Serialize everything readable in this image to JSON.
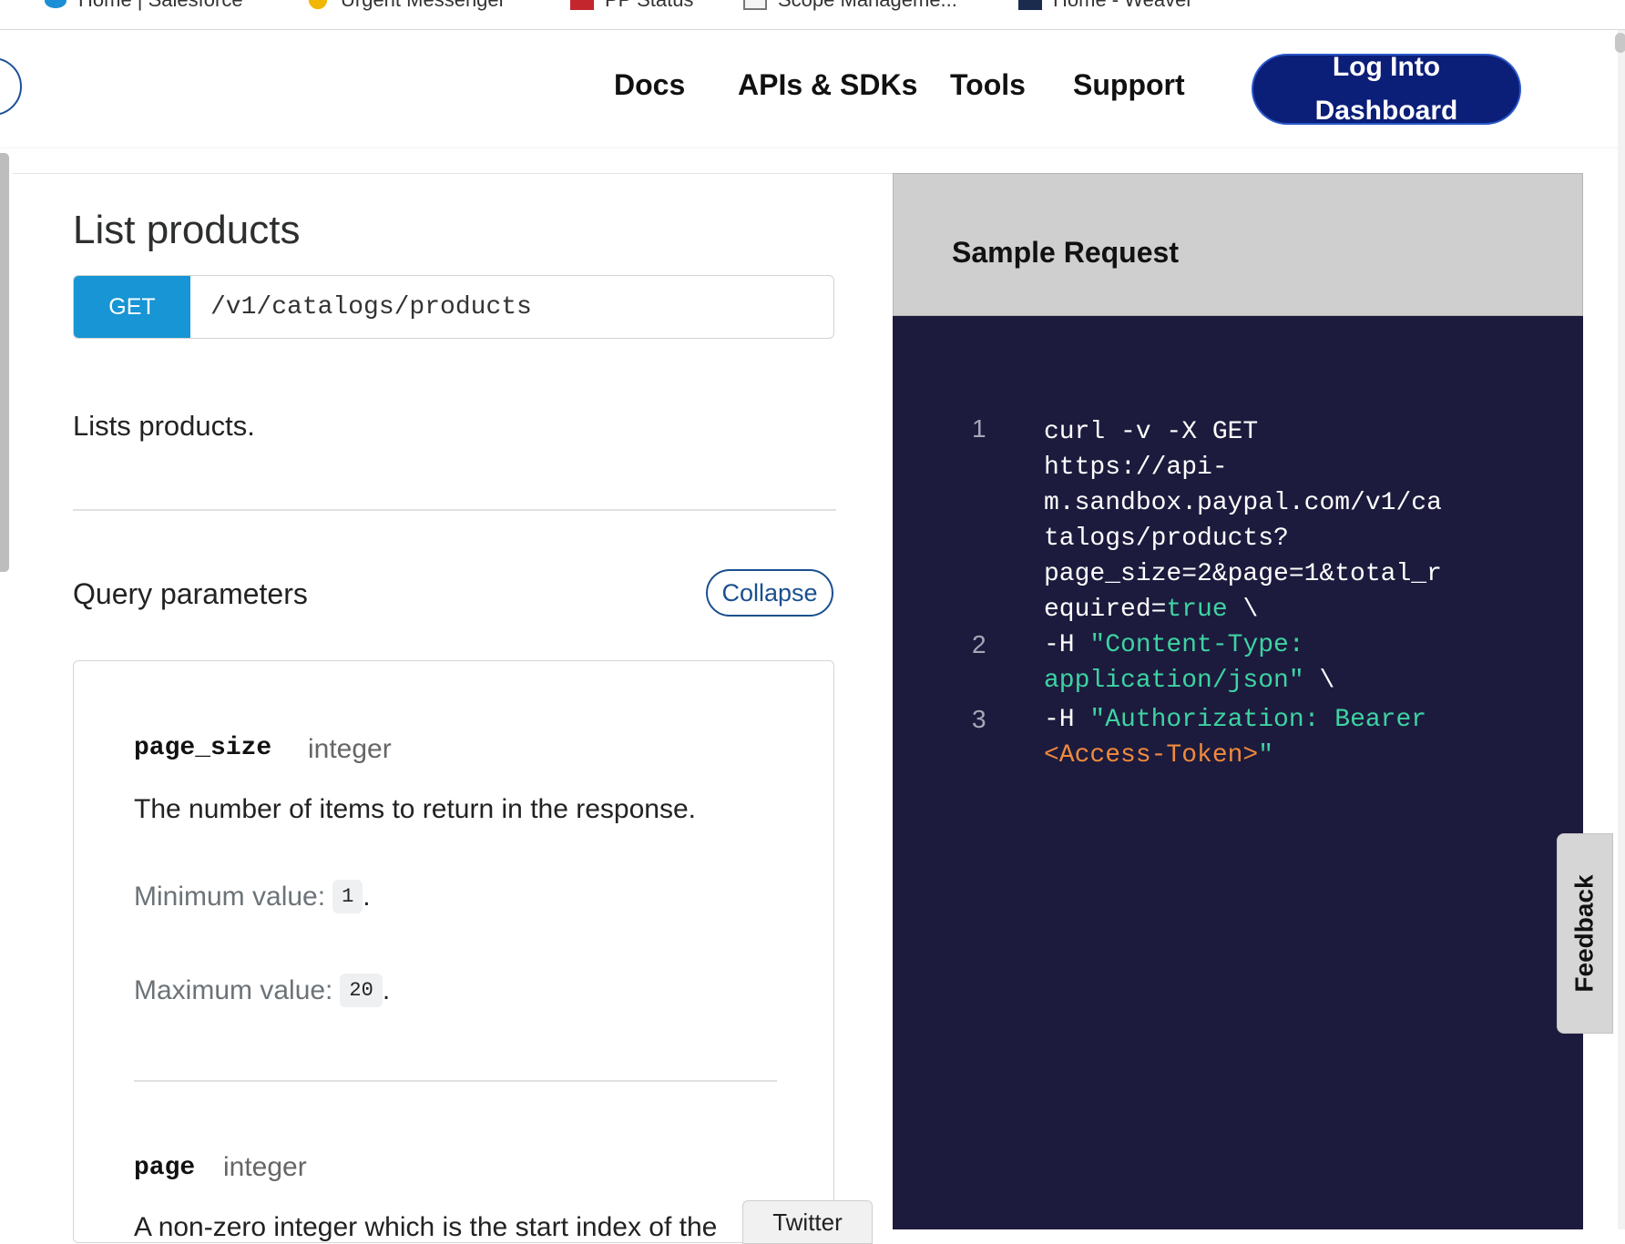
{
  "bookmarks": [
    {
      "label": "Home | Salesforce",
      "icon": "salesforce-cloud-icon",
      "color": "#1a8fd6"
    },
    {
      "label": "Urgent Messenger",
      "icon": "emoji-face-icon",
      "color": "#f2b705"
    },
    {
      "label": "PP Status",
      "icon": "status-grid-icon",
      "color": "#c4262e"
    },
    {
      "label": "Scope Manageme...",
      "icon": "document-icon",
      "color": "#888888"
    },
    {
      "label": "Home - Weaver",
      "icon": "weaver-icon",
      "color": "#1b2b4d"
    }
  ],
  "nav": {
    "docs": "Docs",
    "apis": "APIs & SDKs",
    "tools": "Tools",
    "support": "Support",
    "login": "Log Into Dashboard"
  },
  "endpoint": {
    "title": "List products",
    "method": "GET",
    "path": "/v1/catalogs/products",
    "description": "Lists products."
  },
  "query_params": {
    "title": "Query parameters",
    "collapse_label": "Collapse",
    "params": [
      {
        "name": "page_size",
        "type": "integer",
        "description": "The number of items to return in the response.",
        "min_label": "Minimum value:",
        "min_value": "1",
        "max_label": "Maximum value:",
        "max_value": "20"
      },
      {
        "name": "page",
        "type": "integer",
        "description": "A non-zero integer which is the start index of the"
      }
    ]
  },
  "sample": {
    "title": "Sample Request",
    "lines": [
      {
        "num": "1"
      },
      {
        "num": "2"
      },
      {
        "num": "3"
      }
    ],
    "code": {
      "l1a": "curl -v -X GET",
      "l1b": "https://api-",
      "l1c": "m.sandbox.paypal.com/v1/ca",
      "l1d": "talogs/products?",
      "l1e": "page_size=2&page=1&total_r",
      "l1f_plain": "equired=",
      "l1f_kw": "true",
      "l1f_end": " \\",
      "l2a_plain": "-H ",
      "l2a_str": "\"Content-Type:",
      "l2b_str": "application/json\"",
      "l2b_end": " \\",
      "l3a_plain": "-H ",
      "l3a_str": "\"Authorization: Bearer",
      "l3b_tok": "<Access-Token>",
      "l3b_str": "\""
    }
  },
  "widgets": {
    "twitter": "Twitter",
    "feedback": "Feedback"
  }
}
